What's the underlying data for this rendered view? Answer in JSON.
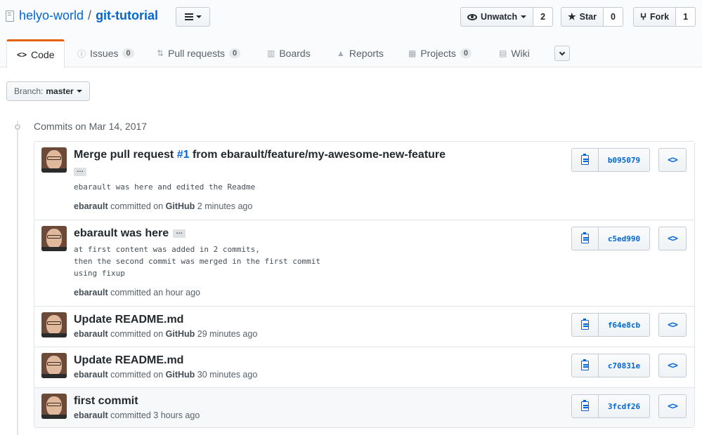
{
  "repo": {
    "owner": "helyo-world",
    "separator": "/",
    "name": "git-tutorial"
  },
  "actions": {
    "watch": {
      "label": "Unwatch",
      "count": "2"
    },
    "star": {
      "label": "Star",
      "count": "0"
    },
    "fork": {
      "label": "Fork",
      "count": "1"
    }
  },
  "tabs": [
    {
      "label": "Code",
      "icon": "<>",
      "counter": null,
      "selected": true
    },
    {
      "label": "Issues",
      "icon": "!",
      "counter": "0"
    },
    {
      "label": "Pull requests",
      "icon": "pr",
      "counter": "0"
    },
    {
      "label": "Boards",
      "icon": "|||"
    },
    {
      "label": "Reports",
      "icon": "graph"
    },
    {
      "label": "Projects",
      "icon": "proj",
      "counter": "0"
    },
    {
      "label": "Wiki",
      "icon": "book"
    }
  ],
  "branch": {
    "label": "Branch:",
    "value": "master"
  },
  "commit_group": {
    "heading": "Commits on Mar 14, 2017"
  },
  "commits": [
    {
      "title_pre": "Merge pull request ",
      "title_link": "#1",
      "title_post": " from ebarault/feature/my-awesome-new-feature",
      "description": "ebarault was here and edited the Readme",
      "author": "ebarault",
      "committed_text": "committed on",
      "platform": "GitHub",
      "time": "2 minutes ago",
      "sha": "b095079",
      "ellipsis": "…"
    },
    {
      "title": "ebarault was here",
      "description": "at first content was added in 2 commits,\nthen the second commit was merged in the first commit\nusing fixup",
      "author": "ebarault",
      "committed_text": "committed",
      "time": "an hour ago",
      "sha": "c5ed990",
      "ellipsis": "…"
    },
    {
      "title": "Update README.md",
      "author": "ebarault",
      "committed_text": "committed on",
      "platform": "GitHub",
      "time": "29 minutes ago",
      "sha": "f64e8cb"
    },
    {
      "title": "Update README.md",
      "author": "ebarault",
      "committed_text": "committed on",
      "platform": "GitHub",
      "time": "30 minutes ago",
      "sha": "c70831e"
    },
    {
      "title": "first commit",
      "author": "ebarault",
      "committed_text": "committed",
      "time": "3 hours ago",
      "sha": "3fcdf26"
    }
  ],
  "colors": {
    "link": "#0366d6",
    "tab_accent": "#e36209",
    "muted": "#586069"
  },
  "browse_symbol": "<>"
}
